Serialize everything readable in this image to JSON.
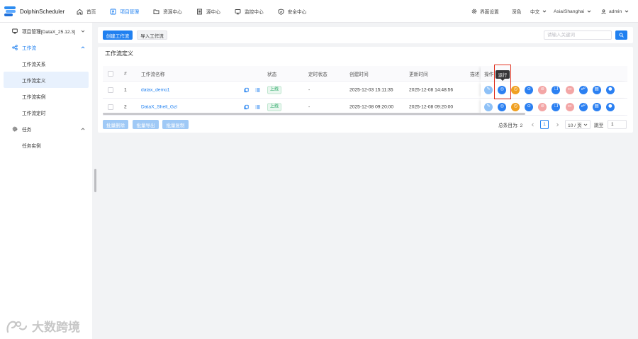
{
  "app": {
    "name": "DolphinScheduler"
  },
  "nav": {
    "home": "首页",
    "project": "项目管理",
    "resource": "资源中心",
    "datasource": "源中心",
    "monitor": "监控中心",
    "security": "安全中心"
  },
  "header_right": {
    "ui_settings": "界面设置",
    "theme": "深色",
    "language": "中文",
    "timezone": "Asia/Shanghai",
    "user": "admin"
  },
  "sidebar": {
    "project": "项目管理[DataX_25.12.3]",
    "workflow": "工作流",
    "workflow_items": [
      "工作流关系",
      "工作流定义",
      "工作流实例",
      "工作流定时"
    ],
    "task": "任务",
    "task_items": [
      "任务实例"
    ]
  },
  "toolbar": {
    "create": "创建工作流",
    "import": "导入工作流",
    "search_placeholder": "请输入关键词"
  },
  "card_title": "工作流定义",
  "table": {
    "columns": {
      "index": "#",
      "name": "工作流名称",
      "status": "状态",
      "schedule": "定时状态",
      "created": "创建时间",
      "updated": "更新时间",
      "description": "描述",
      "operation": "操作"
    },
    "rows": [
      {
        "index": "1",
        "name": "datax_demo1",
        "status": "上线",
        "schedule": "-",
        "created": "2025-12-03 15:11:35",
        "updated": "2025-12-08 14:48:56"
      },
      {
        "index": "2",
        "name": "DataX_Shell_Gzl",
        "status": "上线",
        "schedule": "-",
        "created": "2025-12-08 09:20:00",
        "updated": "2025-12-08 09:20:00"
      }
    ],
    "actions": [
      {
        "icon": "edit-icon",
        "color": "#8ec1f7"
      },
      {
        "icon": "run-icon",
        "color": "#2b80f2"
      },
      {
        "icon": "timing-icon",
        "color": "#f0a020"
      },
      {
        "icon": "offline-icon",
        "color": "#2b80f2"
      },
      {
        "icon": "delete-icon",
        "color": "#f3a6a6"
      },
      {
        "icon": "copy-icon",
        "color": "#2b80f2"
      },
      {
        "icon": "remove-icon",
        "color": "#f3a6a6"
      },
      {
        "icon": "tree-icon",
        "color": "#2b80f2"
      },
      {
        "icon": "export-icon",
        "color": "#2b80f2"
      },
      {
        "icon": "version-icon",
        "color": "#2b80f2"
      }
    ]
  },
  "tooltip": "运行",
  "batch": {
    "delete": "批量删除",
    "export": "批量导出",
    "copy": "批量复制"
  },
  "pagination": {
    "total": "总条目为: 2",
    "current": "1",
    "page_size": "10 / 页",
    "jump_label": "跳至",
    "jump_value": "1"
  },
  "watermark": "大数跨境",
  "colors": {
    "primary": "#2080f0",
    "success": "#18a058",
    "warning": "#f0a020",
    "highlight": "#e0301e"
  }
}
